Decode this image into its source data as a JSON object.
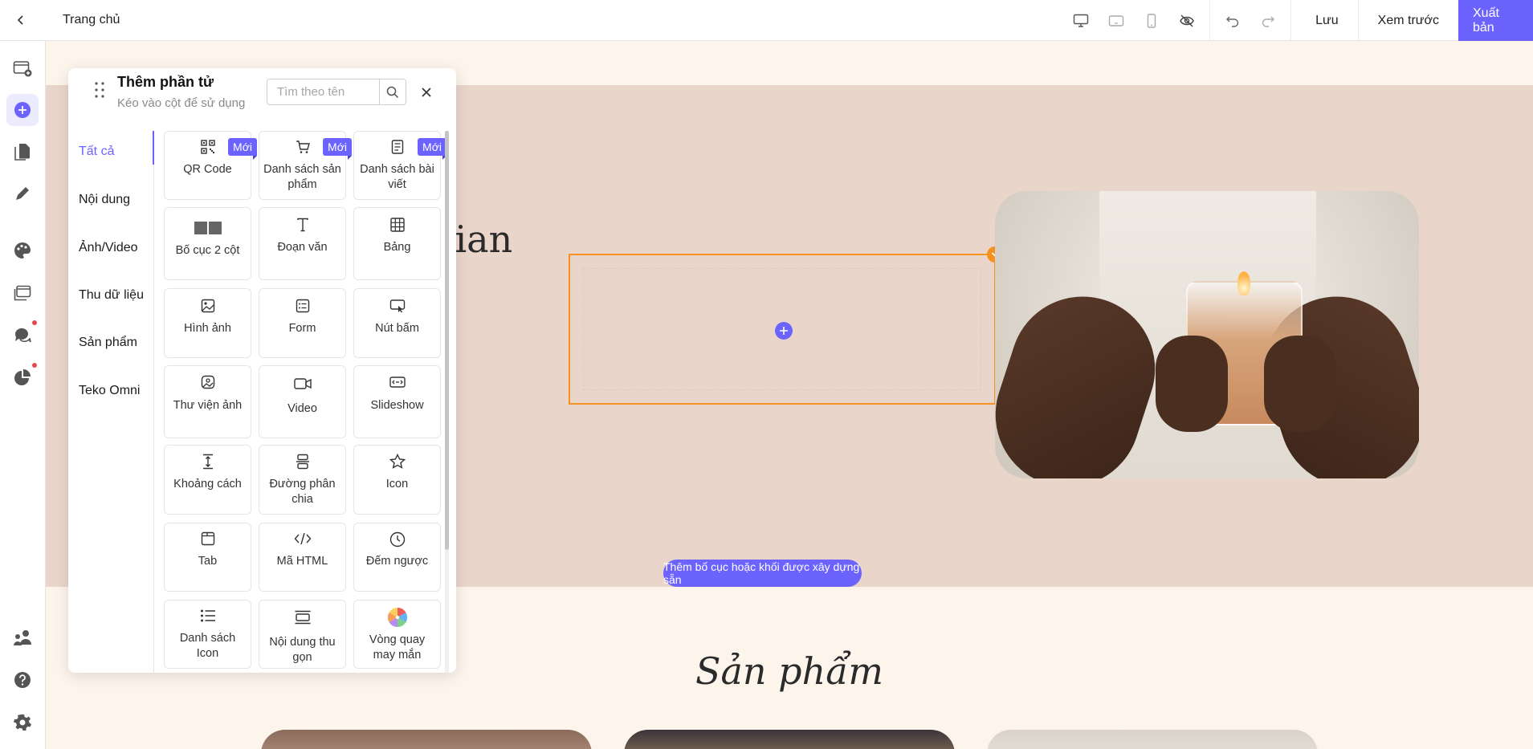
{
  "topbar": {
    "page_name": "Trang chủ",
    "save_label": "Lưu",
    "preview_label": "Xem trước",
    "publish_label": "Xuất bản"
  },
  "canvas": {
    "hero_heading": "gian",
    "prebuilt_button": "Thêm bố cục hoặc khối được xây dựng sẵn",
    "products_title": "Sản phẩm"
  },
  "colors": {
    "accent": "#6c63ff",
    "selection": "#f5911e",
    "hero_bg": "#ead5cb",
    "page_bg": "#fdf4ec"
  },
  "panel": {
    "title": "Thêm phần tử",
    "subtitle": "Kéo vào cột để sử dụng",
    "search_placeholder": "Tìm theo tên",
    "categories": [
      {
        "label": "Tất cả",
        "active": true
      },
      {
        "label": "Nội dung"
      },
      {
        "label": "Ảnh/Video"
      },
      {
        "label": "Thu dữ liệu"
      },
      {
        "label": "Sản phẩm"
      },
      {
        "label": "Teko Omni"
      }
    ],
    "badge": "Mới",
    "elements": [
      {
        "label": "QR Code",
        "icon": "qr-code-icon",
        "badge": true
      },
      {
        "label": "Danh sách sản phẩm",
        "icon": "cart-icon",
        "badge": true
      },
      {
        "label": "Danh sách bài viết",
        "icon": "document-list-icon",
        "badge": true
      },
      {
        "label": "Bố cục 2 cột",
        "icon": "two-column-icon"
      },
      {
        "label": "Đoạn văn",
        "icon": "text-icon"
      },
      {
        "label": "Bảng",
        "icon": "table-icon"
      },
      {
        "label": "Hình ảnh",
        "icon": "image-icon"
      },
      {
        "label": "Form",
        "icon": "form-icon"
      },
      {
        "label": "Nút bấm",
        "icon": "button-icon"
      },
      {
        "label": "Thư viện ảnh",
        "icon": "gallery-icon"
      },
      {
        "label": "Video",
        "icon": "video-icon"
      },
      {
        "label": "Slideshow",
        "icon": "slideshow-icon"
      },
      {
        "label": "Khoảng cách",
        "icon": "spacer-icon"
      },
      {
        "label": "Đường phân chia",
        "icon": "divider-icon"
      },
      {
        "label": "Icon",
        "icon": "star-icon"
      },
      {
        "label": "Tab",
        "icon": "tab-icon"
      },
      {
        "label": "Mã HTML",
        "icon": "code-icon"
      },
      {
        "label": "Đếm ngược",
        "icon": "clock-icon"
      },
      {
        "label": "Danh sách Icon",
        "icon": "icon-list-icon"
      },
      {
        "label": "Nội dung thu gọn",
        "icon": "collapse-icon"
      },
      {
        "label": "Vòng quay may mắn",
        "icon": "lucky-wheel-icon"
      }
    ]
  }
}
